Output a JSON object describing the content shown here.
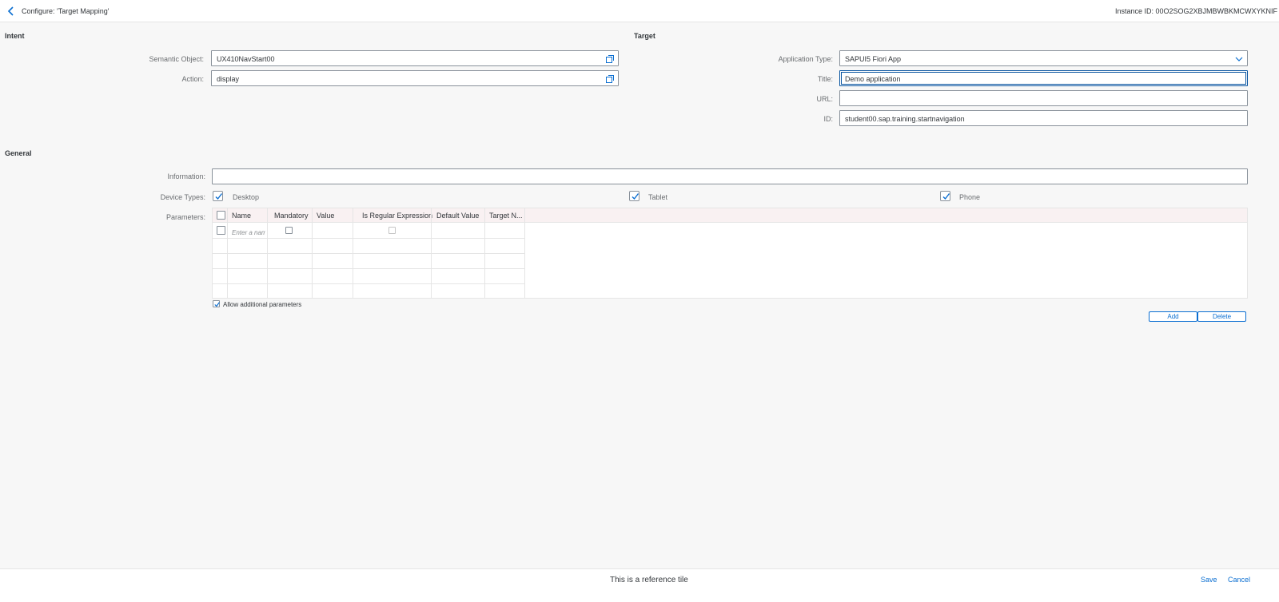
{
  "header": {
    "title": "Configure: 'Target Mapping'",
    "instance_id": "Instance ID: 00O2SOG2XBJMBWBKMCWXYKNIF"
  },
  "intent": {
    "title": "Intent",
    "semantic_object_label": "Semantic Object:",
    "semantic_object_value": "UX410NavStart00",
    "action_label": "Action:",
    "action_value": "display"
  },
  "target": {
    "title": "Target",
    "app_type_label": "Application Type:",
    "app_type_value": "SAPUI5 Fiori App",
    "title_label": "Title:",
    "title_value": "Demo application",
    "url_label": "URL:",
    "url_value": "",
    "id_label": "ID:",
    "id_value": "student00.sap.training.startnavigation"
  },
  "general": {
    "title": "General",
    "information_label": "Information:",
    "information_value": "",
    "device_types_label": "Device Types:",
    "devices": [
      {
        "label": "Desktop",
        "checked": true
      },
      {
        "label": "Tablet",
        "checked": true
      },
      {
        "label": "Phone",
        "checked": true
      }
    ],
    "parameters_label": "Parameters:",
    "table": {
      "columns": [
        "Name",
        "Mandatory",
        "Value",
        "Is Regular Expression",
        "Default Value",
        "Target N..."
      ],
      "name_placeholder": "Enter a name"
    },
    "allow_additional": "Allow additional parameters",
    "add_label": "Add",
    "delete_label": "Delete"
  },
  "footer": {
    "message": "This is a reference tile",
    "save_label": "Save",
    "cancel_label": "Cancel"
  },
  "colors": {
    "accent": "#0a6ed1",
    "focus": "#0854a0",
    "background": "#f7f7f7"
  }
}
